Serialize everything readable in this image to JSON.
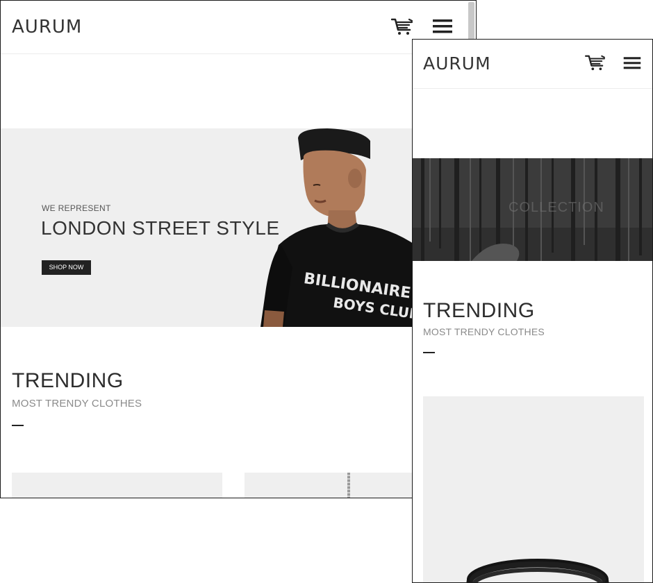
{
  "brand": {
    "logo_text": "AURUM"
  },
  "header": {
    "cart_icon": "shopping-cart-icon",
    "menu_icon": "hamburger-menu-icon"
  },
  "hero": {
    "kicker": "WE REPRESENT",
    "title": "LONDON STREET STYLE",
    "button_label": "SHOP NOW",
    "tshirt_print_line1": "BILLIONAIRE",
    "tshirt_print_line2": "BOYS CLUB",
    "background_color": "#efefef"
  },
  "collection_banner": {
    "text": "COLLECTION"
  },
  "trending": {
    "title": "TRENDING",
    "subtitle": "MOST TRENDY CLOTHES"
  },
  "colors": {
    "accent_dark": "#222222",
    "text_muted": "#8a8a8a",
    "card_background": "#efefef"
  }
}
